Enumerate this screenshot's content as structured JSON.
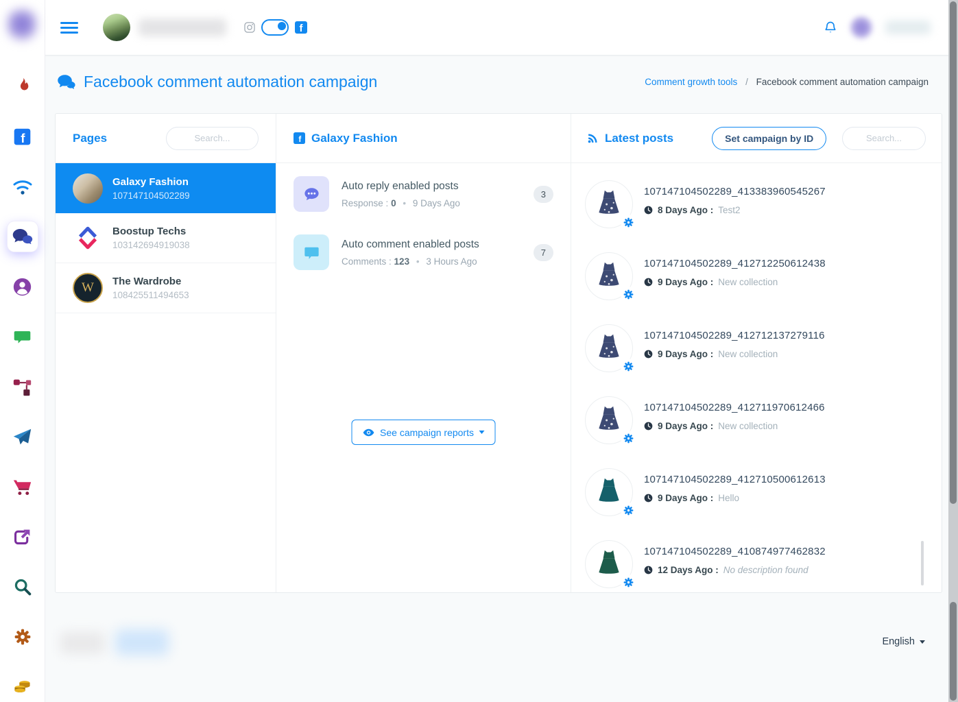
{
  "colors": {
    "primary": "#1289f0",
    "selected_row": "#0e8bf1",
    "reply_tile_bg": "#e0e2fb",
    "comment_tile_bg": "#cdeefa"
  },
  "page": {
    "title": "Facebook comment automation campaign",
    "breadcrumb_link": "Comment growth tools",
    "breadcrumb_sep": "/",
    "breadcrumb_current": "Facebook comment automation campaign"
  },
  "pages_panel": {
    "title": "Pages",
    "search_placeholder": "Search...",
    "items": [
      {
        "name": "Galaxy Fashion",
        "id": "107147104502289"
      },
      {
        "name": "Boostup Techs",
        "id": "103142694919038"
      },
      {
        "name": "The Wardrobe",
        "id": "108425511494653",
        "monogram": "W"
      }
    ]
  },
  "page_detail": {
    "title": "Galaxy Fashion",
    "rows": [
      {
        "title": "Auto reply enabled posts",
        "meta_label": "Response :",
        "meta_value": "0",
        "meta_sep": "•",
        "meta_time": "9 Days Ago",
        "badge": "3"
      },
      {
        "title": "Auto comment enabled posts",
        "meta_label": "Comments :",
        "meta_value": "123",
        "meta_sep": "•",
        "meta_time": "3 Hours Ago",
        "badge": "7"
      }
    ],
    "reports_button": "See campaign reports"
  },
  "posts_panel": {
    "title": "Latest posts",
    "set_campaign_button": "Set campaign by ID",
    "search_placeholder": "Search...",
    "posts": [
      {
        "id": "107147104502289_413383960545267",
        "age": "8 Days Ago :",
        "description": "Test2",
        "desc_style": "",
        "thumb_color": "#3d4a73",
        "pattern_opacity": "0.85"
      },
      {
        "id": "107147104502289_412712250612438",
        "age": "9 Days Ago :",
        "description": "New collection",
        "desc_style": "",
        "thumb_color": "#3d4a73",
        "pattern_opacity": "0.85"
      },
      {
        "id": "107147104502289_412712137279116",
        "age": "9 Days Ago :",
        "description": "New collection",
        "desc_style": "",
        "thumb_color": "#3d4a73",
        "pattern_opacity": "0.85"
      },
      {
        "id": "107147104502289_412711970612466",
        "age": "9 Days Ago :",
        "description": "New collection",
        "desc_style": "",
        "thumb_color": "#3d4a73",
        "pattern_opacity": "0.85"
      },
      {
        "id": "107147104502289_412710500612613",
        "age": "9 Days Ago :",
        "description": "Hello",
        "desc_style": "",
        "thumb_color": "#15606a",
        "pattern_opacity": "0"
      },
      {
        "id": "107147104502289_410874977462832",
        "age": "12 Days Ago :",
        "description": "No description found",
        "desc_style": "font-style:italic",
        "thumb_color": "#1d5c4b",
        "pattern_opacity": "0"
      }
    ]
  },
  "footer": {
    "language": "English"
  }
}
